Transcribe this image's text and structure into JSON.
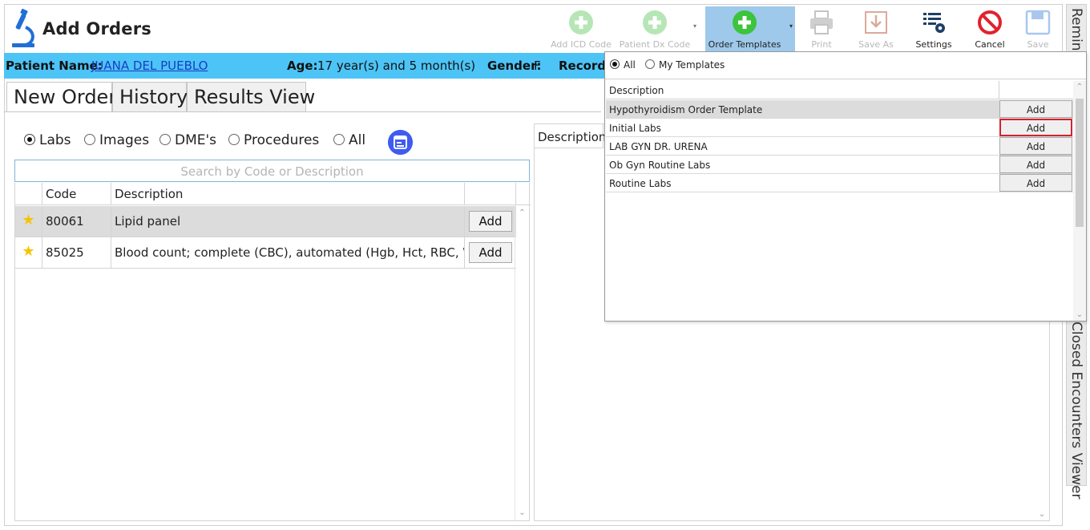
{
  "header": {
    "title": "Add Orders"
  },
  "toolbar": {
    "add_icd_code": "Add ICD Code",
    "patient_dx_code": "Patient Dx Code",
    "order_templates": "Order Templates",
    "print": "Print",
    "save_as": "Save As",
    "settings": "Settings",
    "cancel": "Cancel",
    "save": "Save"
  },
  "patient": {
    "name_label": "Patient Name:",
    "name": "JUANA DEL PUEBLO ",
    "age_label": "Age:",
    "age": "17 year(s) and 5 month(s)",
    "gender_label": "Gender:",
    "gender": "F",
    "record_label": "Record"
  },
  "tabs": [
    "New Order",
    "History",
    "Results View"
  ],
  "filters": {
    "labs": "Labs",
    "images": "Images",
    "dmes": "DME's",
    "procedures": "Procedures",
    "all": "All"
  },
  "search": {
    "placeholder": "Search by Code or Description"
  },
  "code_table": {
    "col_code": "Code",
    "col_description": "Description",
    "rows": [
      {
        "code": "80061",
        "description": "Lipid panel",
        "action": "Add"
      },
      {
        "code": "85025",
        "description": "Blood count; complete (CBC), automated (Hgb, Hct, RBC, W...",
        "action": "Add"
      }
    ]
  },
  "right_panel": {
    "col_description": "Description"
  },
  "side_tabs": {
    "reminders": "Remind",
    "closed_encounters": "Closed Encounters Viewer"
  },
  "templates_popup": {
    "radio_all": "All",
    "radio_my": "My Templates",
    "col_description": "Description",
    "rows": [
      {
        "name": "Hypothyroidism Order Template",
        "action": "Add"
      },
      {
        "name": "Initial Labs",
        "action": "Add"
      },
      {
        "name": "LAB GYN DR. URENA",
        "action": "Add"
      },
      {
        "name": "Ob Gyn Routine Labs",
        "action": "Add"
      },
      {
        "name": "Routine Labs",
        "action": "Add"
      }
    ]
  },
  "colors": {
    "patient_bar": "#4dc4f6",
    "green_icon": "#3cc43c",
    "green_icon_disabled": "#b6e6b6",
    "cancel_red": "#e0232e",
    "highlight_red": "#d3232e",
    "filter_blue": "#3f5bf1"
  },
  "icons": {
    "logo": "microscope-icon",
    "add_icd_code": "plus-circle-icon",
    "patient_dx_code": "plus-circle-icon",
    "order_templates": "plus-circle-icon",
    "print": "printer-icon",
    "save_as": "save-as-icon",
    "settings": "settings-list-icon",
    "cancel": "cancel-icon",
    "save": "floppy-icon",
    "favorite": "star-icon",
    "filter": "calendar-filter-icon"
  }
}
